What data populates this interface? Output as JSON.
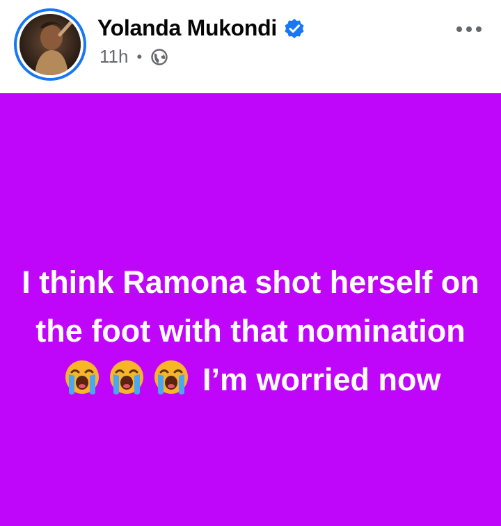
{
  "post": {
    "author": "Yolanda Mukondi",
    "verified_icon": "verified-badge-icon",
    "time": "11h",
    "separator": "•",
    "audience_icon": "globe-icon",
    "more_icon": "more-options-icon",
    "body_before": "I think Ramona shot herself on the foot with that nomination",
    "emojis": [
      "loudly-crying-face",
      "loudly-crying-face",
      "loudly-crying-face"
    ],
    "body_after": "I’m worried now"
  },
  "colors": {
    "background": "#c005fb",
    "text": "#ffffff",
    "accent": "#1877f2",
    "meta": "#65676b"
  }
}
